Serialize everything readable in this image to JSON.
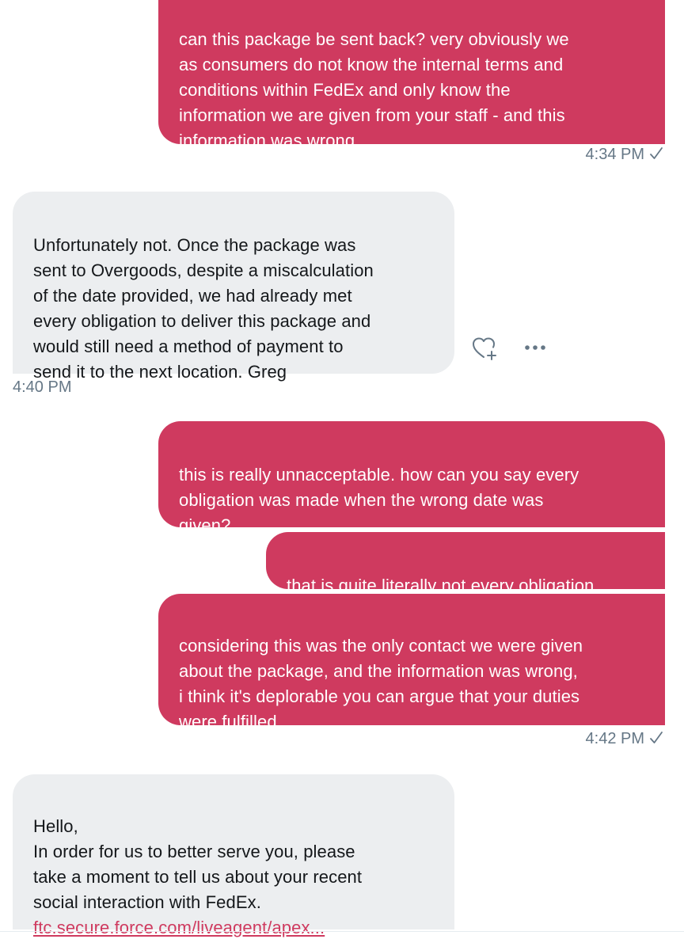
{
  "theme": {
    "sent_bubble_color": "#cf3a5f",
    "received_bubble_color": "#eceef0",
    "timestamp_color": "#657786",
    "link_color": "#cf3a5f"
  },
  "messages": [
    {
      "direction": "sent",
      "text": "can this package be sent back? very obviously we\nas consumers do not know the internal terms and\nconditions within FedEx and only know the\ninformation we are given from your staff - and this\ninformation was wrong"
    },
    {
      "direction": "received",
      "text": "Unfortunately not. Once the package was\nsent to Overgoods, despite a miscalculation\nof the date provided, we had already met\nevery obligation to deliver this package and\nwould still need a method of payment to\nsend it to the next location. Greg"
    },
    {
      "direction": "sent",
      "text": "this is really unnacceptable. how can you say every\nobligation was made when the wrong date was\ngiven?"
    },
    {
      "direction": "sent",
      "text": "that is quite literally not every obligation"
    },
    {
      "direction": "sent",
      "text": "considering this was the only contact we were given\nabout the package, and the information was wrong,\ni think it's deplorable you can argue that your duties\nwere fulfilled"
    },
    {
      "direction": "received",
      "text": "Hello,\nIn order for us to better serve you, please\ntake a moment to tell us about your recent\nsocial interaction with FedEx.",
      "link": "ftc.secure.force.com/liveagent/apex..."
    }
  ],
  "timestamps": {
    "sent_1": "4:34 PM",
    "received_1": "4:40 PM",
    "sent_2": "4:42 PM"
  },
  "icons": {
    "read_receipt": "checkmark-icon",
    "like": "heart-plus-icon",
    "more": "more-options-icon"
  }
}
